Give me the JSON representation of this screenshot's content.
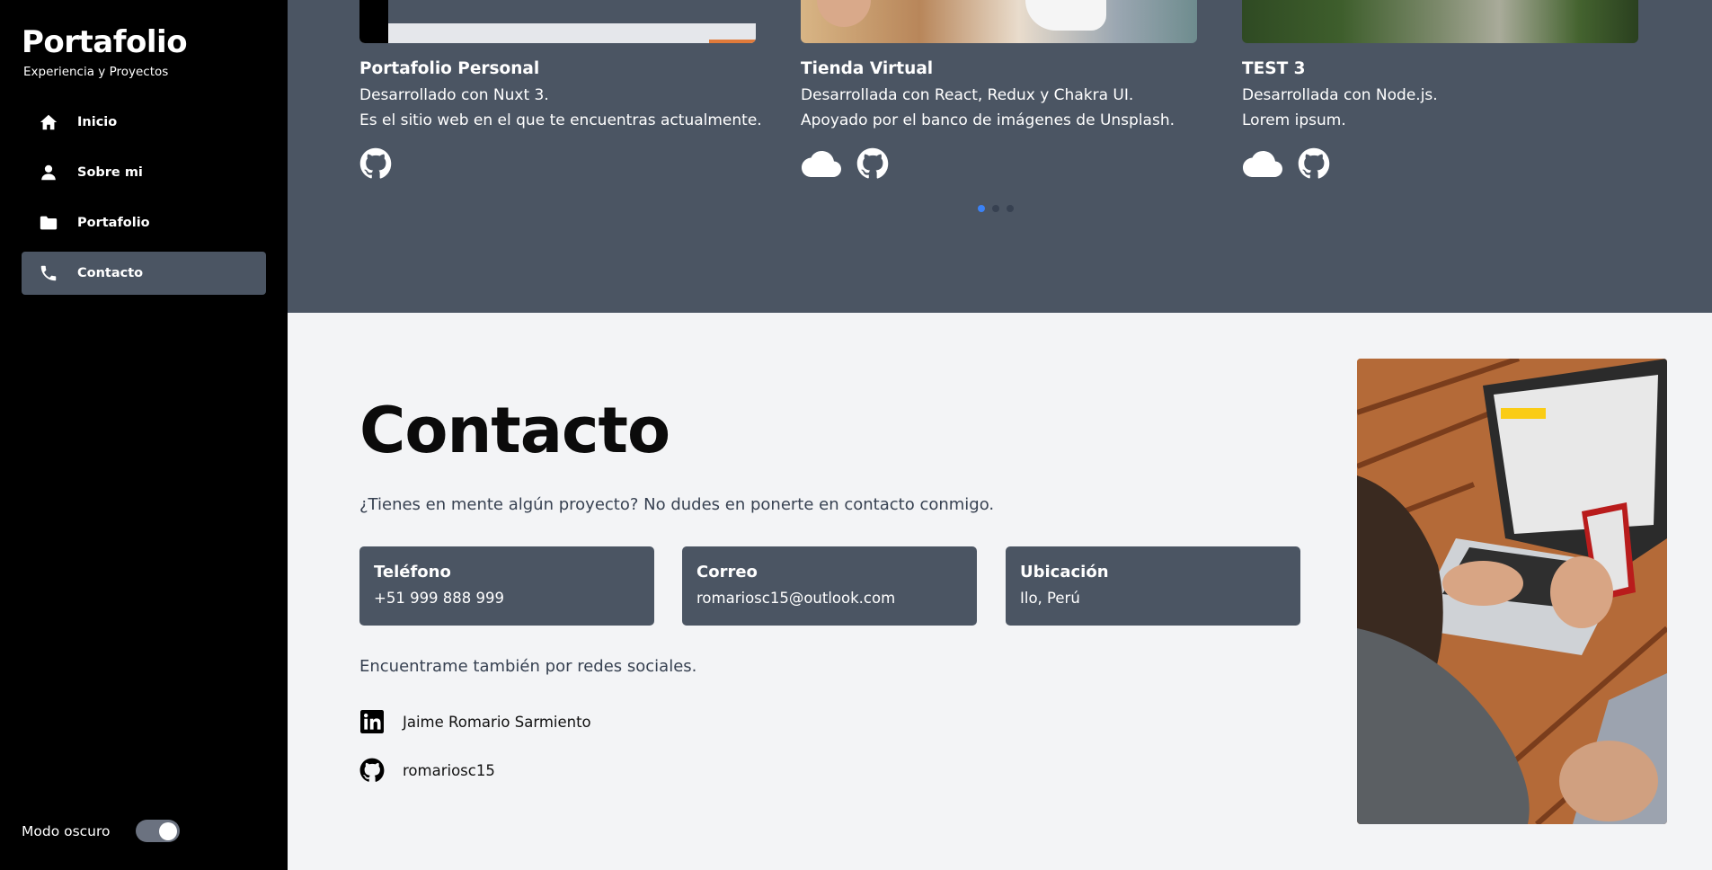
{
  "sidebar": {
    "title": "Portafolio",
    "subtitle": "Experiencia y Proyectos",
    "items": [
      {
        "label": "Inicio",
        "icon": "home-icon"
      },
      {
        "label": "Sobre mi",
        "icon": "user-icon"
      },
      {
        "label": "Portafolio",
        "icon": "folder-icon"
      },
      {
        "label": "Contacto",
        "icon": "phone-icon",
        "active": true
      }
    ],
    "dark_mode_label": "Modo oscuro",
    "dark_mode_on": true
  },
  "projects": {
    "cards": [
      {
        "title": "Portafolio Personal",
        "line1": "Desarrollado con Nuxt 3.",
        "line2": "Es el sitio web en el que te encuentras actualmente.",
        "links": [
          "github-icon"
        ]
      },
      {
        "title": "Tienda Virtual",
        "line1": "Desarrollada con React, Redux y Chakra UI.",
        "line2": "Apoyado por el banco de imágenes de Unsplash.",
        "links": [
          "cloud-icon",
          "github-icon"
        ]
      },
      {
        "title": "TEST 3",
        "line1": "Desarrollada con Node.js.",
        "line2": "Lorem ipsum.",
        "links": [
          "cloud-icon",
          "github-icon"
        ]
      }
    ],
    "carousel_active": 1,
    "carousel_count": 3
  },
  "contact": {
    "title": "Contacto",
    "subtitle": "¿Tienes en mente algún proyecto? No dudes en ponerte en contacto conmigo.",
    "cards": [
      {
        "label": "Teléfono",
        "value": "+51 999 888 999"
      },
      {
        "label": "Correo",
        "value": "romariosc15@outlook.com"
      },
      {
        "label": "Ubicación",
        "value": "Ilo, Perú"
      }
    ],
    "social_intro": "Encuentrame también por redes sociales.",
    "social": [
      {
        "label": "Jaime Romario Sarmiento",
        "icon": "linkedin-icon"
      },
      {
        "label": "romariosc15",
        "icon": "github-icon"
      }
    ]
  },
  "colors": {
    "sidebar_bg": "#000000",
    "accent": "#4b5563",
    "page_bg": "#f3f4f6",
    "carousel_active": "#3b82f6"
  }
}
